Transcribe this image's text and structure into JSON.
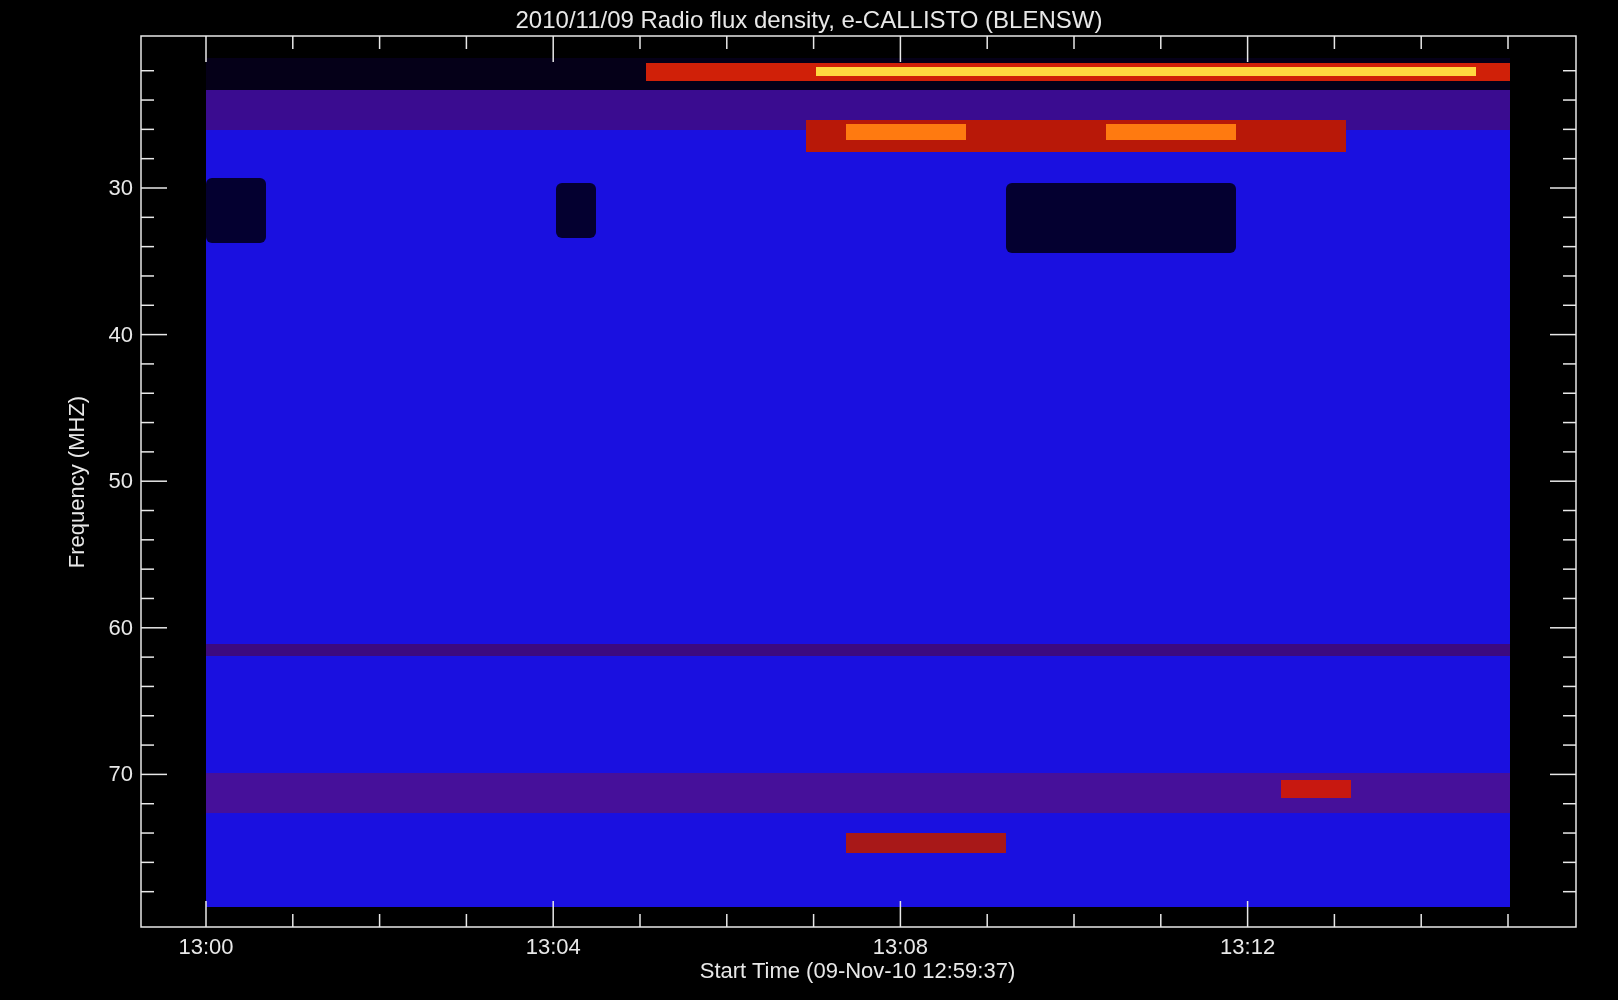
{
  "title": "2010/11/09  Radio flux density, e-CALLISTO (BLENSW)",
  "ylabel": "Frequency (MHZ)",
  "xlabel": "Start Time (09-Nov-10 12:59:37)",
  "yticks": [
    "30",
    "40",
    "50",
    "60",
    "70"
  ],
  "xticks": [
    "13:00",
    "13:04",
    "13:08",
    "13:12"
  ]
}
